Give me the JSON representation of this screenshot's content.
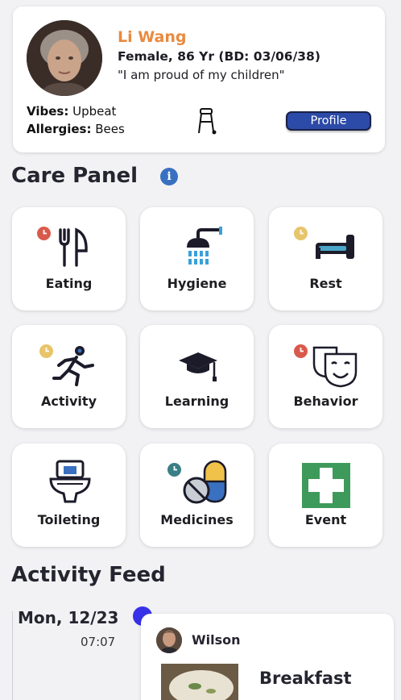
{
  "profile": {
    "name": "Li Wang",
    "demographics": "Female, 86 Yr (BD: 03/06/38)",
    "quote": "\"I am proud of my children\"",
    "vibes_label": "Vibes:",
    "vibes_value": "Upbeat",
    "allergies_label": "Allergies:",
    "allergies_value": "Bees",
    "profile_button": "Profile"
  },
  "care_panel": {
    "title": "Care Panel",
    "info_glyph": "i",
    "tiles": [
      {
        "label": "Eating",
        "icon": "utensils-icon",
        "clock": "red"
      },
      {
        "label": "Hygiene",
        "icon": "shower-icon",
        "clock": null
      },
      {
        "label": "Rest",
        "icon": "bed-icon",
        "clock": "yellow"
      },
      {
        "label": "Activity",
        "icon": "running-person-icon",
        "clock": "yellow"
      },
      {
        "label": "Learning",
        "icon": "graduation-cap-icon",
        "clock": null
      },
      {
        "label": "Behavior",
        "icon": "theater-masks-icon",
        "clock": "red"
      },
      {
        "label": "Toileting",
        "icon": "toilet-icon",
        "clock": null
      },
      {
        "label": "Medicines",
        "icon": "pills-icon",
        "clock": "teal"
      },
      {
        "label": "Event",
        "icon": "first-aid-icon",
        "clock": null
      }
    ]
  },
  "activity_feed": {
    "title": "Activity Feed",
    "date": "Mon, 12/23",
    "time": "07:07",
    "entry": {
      "author": "Wilson",
      "meal": "Breakfast"
    }
  },
  "colors": {
    "accent_orange": "#e98a3f",
    "profile_button": "#2c4aa8",
    "clock_red": "#d95a4c",
    "clock_yellow": "#e8c46a",
    "clock_teal": "#3a7f86",
    "feed_dot": "#3731e8",
    "event_green": "#3e9a5a"
  }
}
